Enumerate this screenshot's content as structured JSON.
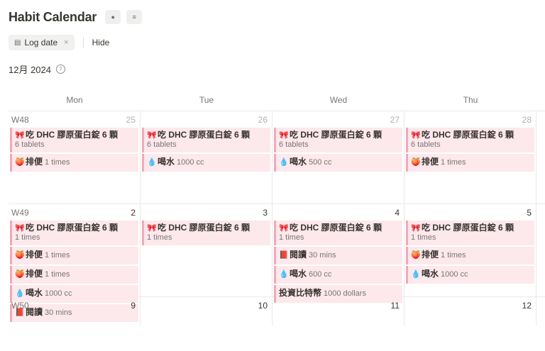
{
  "page": {
    "title": "Habit Calendar",
    "filter_chip": "Log date",
    "hide_label": "Hide",
    "month_label": "12月 2024"
  },
  "weekdays": [
    "Mon",
    "Tue",
    "Wed",
    "Thu"
  ],
  "icons": {
    "ribbon": "ribbon-icon",
    "drop": "water-drop-icon",
    "peach": "peach-icon",
    "book": "book-icon"
  },
  "weeks": [
    {
      "label": "W48",
      "days": [
        {
          "num": "25",
          "dim": true,
          "cards": [
            {
              "title": "吃 DHC 膠原蛋白錠 6 顆",
              "sub": "6 tablets",
              "icon": "ribbon"
            },
            {
              "name": "排便",
              "value": "1 times",
              "icon": "peach"
            }
          ]
        },
        {
          "num": "26",
          "dim": true,
          "cards": [
            {
              "title": "吃 DHC 膠原蛋白錠 6 顆",
              "sub": "6 tablets",
              "icon": "ribbon"
            },
            {
              "name": "喝水",
              "value": "1000 cc",
              "icon": "drop"
            }
          ]
        },
        {
          "num": "27",
          "dim": true,
          "cards": [
            {
              "title": "吃 DHC 膠原蛋白錠 6 顆",
              "sub": "6 tablets",
              "icon": "ribbon"
            },
            {
              "name": "喝水",
              "value": "500 cc",
              "icon": "drop"
            }
          ]
        },
        {
          "num": "28",
          "dim": true,
          "cards": [
            {
              "title": "吃 DHC 膠原蛋白錠 6 顆",
              "sub": "6 tablets",
              "icon": "ribbon"
            },
            {
              "name": "排便",
              "value": "1 times",
              "icon": "peach"
            }
          ]
        }
      ]
    },
    {
      "label": "W49",
      "days": [
        {
          "num": "2",
          "dim": false,
          "cards": [
            {
              "title": "吃 DHC 膠原蛋白錠 6 顆",
              "sub": "1 times",
              "icon": "ribbon"
            },
            {
              "name": "排便",
              "value": "1 times",
              "icon": "peach"
            },
            {
              "name": "排便",
              "value": "1 times",
              "icon": "peach"
            },
            {
              "name": "喝水",
              "value": "1000 cc",
              "icon": "drop"
            },
            {
              "name": "閱讀",
              "value": "30 mins",
              "icon": "book"
            }
          ]
        },
        {
          "num": "3",
          "dim": false,
          "cards": [
            {
              "title": "吃 DHC 膠原蛋白錠 6 顆",
              "sub": "1 times",
              "icon": "ribbon"
            }
          ]
        },
        {
          "num": "4",
          "dim": false,
          "cards": [
            {
              "title": "吃 DHC 膠原蛋白錠 6 顆",
              "sub": "1 times",
              "icon": "ribbon"
            },
            {
              "name": "閱讀",
              "value": "30 mins",
              "icon": "book"
            },
            {
              "name": "喝水",
              "value": "600 cc",
              "icon": "drop"
            },
            {
              "name": "投資比特幣",
              "value": "1000 dollars",
              "icon": ""
            }
          ]
        },
        {
          "num": "5",
          "dim": false,
          "cards": [
            {
              "title": "吃 DHC 膠原蛋白錠 6 顆",
              "sub": "1 times",
              "icon": "ribbon"
            },
            {
              "name": "排便",
              "value": "1 times",
              "icon": "peach"
            },
            {
              "name": "喝水",
              "value": "1000 cc",
              "icon": "drop"
            }
          ]
        }
      ]
    },
    {
      "label": "W50",
      "days": [
        {
          "num": "9",
          "dim": false,
          "cards": []
        },
        {
          "num": "10",
          "dim": false,
          "cards": []
        },
        {
          "num": "11",
          "dim": false,
          "cards": []
        },
        {
          "num": "12",
          "dim": false,
          "cards": []
        }
      ]
    }
  ]
}
